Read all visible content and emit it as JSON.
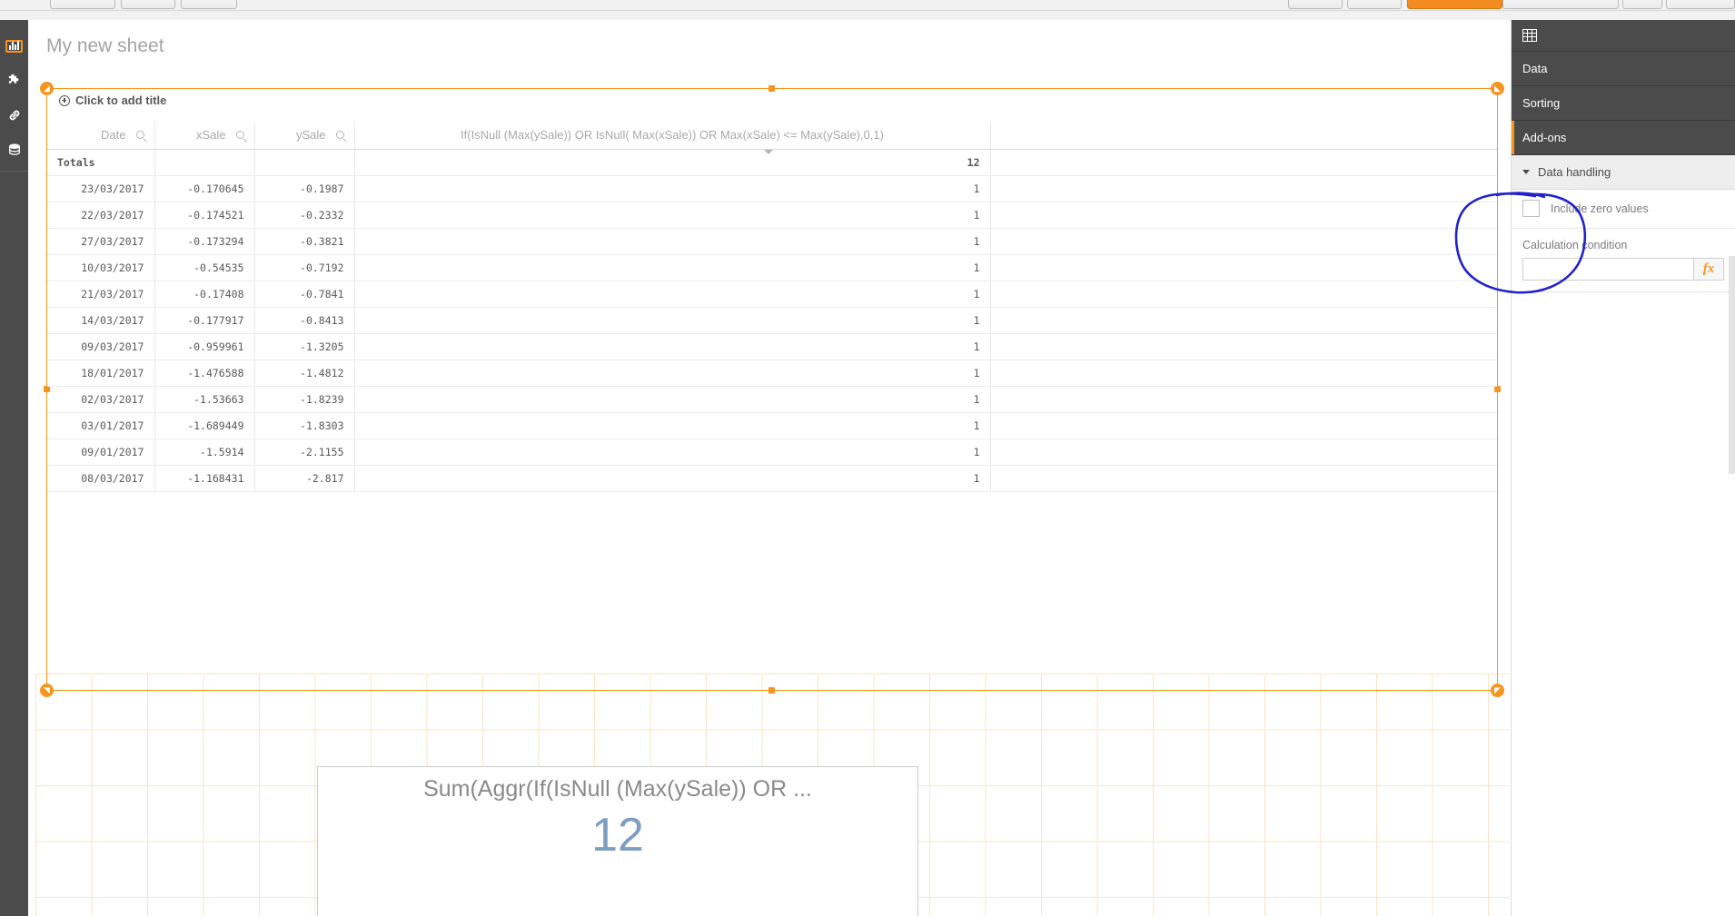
{
  "browser_chrome": {
    "buttons": [
      "toolbar-button-1",
      "toolbar-button-2",
      "toolbar-button-3"
    ],
    "right_buttons": [
      "star-button",
      "extension-button",
      "active-app-button",
      "address-field",
      "menu-button",
      "minimize-button",
      "maximize-button"
    ],
    "accent_color": "#f28b20"
  },
  "rail": {
    "items": [
      {
        "name": "charts",
        "icon": "bar-chart-icon",
        "selected": true
      },
      {
        "name": "custom-objects",
        "icon": "puzzle-piece-icon",
        "selected": false
      },
      {
        "name": "master-items-link",
        "icon": "link-icon",
        "selected": false
      },
      {
        "name": "fields",
        "icon": "database-icon",
        "selected": false
      }
    ]
  },
  "sheet": {
    "title": "My new sheet",
    "add_title_label": "Click to add title"
  },
  "table": {
    "columns": [
      {
        "label": "Date",
        "search": true
      },
      {
        "label": "xSale",
        "search": true
      },
      {
        "label": "ySale",
        "search": true
      },
      {
        "label": "If(IsNull (Max(ySale)) OR IsNull( Max(xSale)) OR Max(xSale) <= Max(ySale),0,1)",
        "search": false
      }
    ],
    "totals_label": "Totals",
    "totals_value": "12",
    "rows": [
      {
        "date": "23/03/2017",
        "xsale": "-0.170645",
        "ysale": "-0.1987",
        "expr": "1"
      },
      {
        "date": "22/03/2017",
        "xsale": "-0.174521",
        "ysale": "-0.2332",
        "expr": "1"
      },
      {
        "date": "27/03/2017",
        "xsale": "-0.173294",
        "ysale": "-0.3821",
        "expr": "1"
      },
      {
        "date": "10/03/2017",
        "xsale": "-0.54535",
        "ysale": "-0.7192",
        "expr": "1"
      },
      {
        "date": "21/03/2017",
        "xsale": "-0.17408",
        "ysale": "-0.7841",
        "expr": "1"
      },
      {
        "date": "14/03/2017",
        "xsale": "-0.177917",
        "ysale": "-0.8413",
        "expr": "1"
      },
      {
        "date": "09/03/2017",
        "xsale": "-0.959961",
        "ysale": "-1.3205",
        "expr": "1"
      },
      {
        "date": "18/01/2017",
        "xsale": "-1.476588",
        "ysale": "-1.4812",
        "expr": "1"
      },
      {
        "date": "02/03/2017",
        "xsale": "-1.53663",
        "ysale": "-1.8239",
        "expr": "1"
      },
      {
        "date": "03/01/2017",
        "xsale": "-1.689449",
        "ysale": "-1.8303",
        "expr": "1"
      },
      {
        "date": "09/01/2017",
        "xsale": "-1.5914",
        "ysale": "-2.1155",
        "expr": "1"
      },
      {
        "date": "08/03/2017",
        "xsale": "-1.168431",
        "ysale": "-2.817",
        "expr": "1"
      }
    ]
  },
  "kpi": {
    "title": "Sum(Aggr(If(IsNull (Max(ySale)) OR ...",
    "value": "12",
    "value_color": "#7d9ec0"
  },
  "panel": {
    "header_icon": "table-icon",
    "tabs": [
      {
        "label": "Data",
        "active": false
      },
      {
        "label": "Sorting",
        "active": false
      },
      {
        "label": "Add-ons",
        "active": true
      }
    ],
    "section": {
      "title": "Data handling",
      "expanded": true,
      "include_zero_values": {
        "label": "Include zero values",
        "checked": false
      },
      "calculation_condition": {
        "label": "Calculation condition",
        "value": "",
        "placeholder": "",
        "expression_button": "fx"
      }
    }
  },
  "annotation": {
    "type": "hand-drawn-ellipse",
    "color": "#2020d0",
    "target": "calculation-condition-area"
  }
}
